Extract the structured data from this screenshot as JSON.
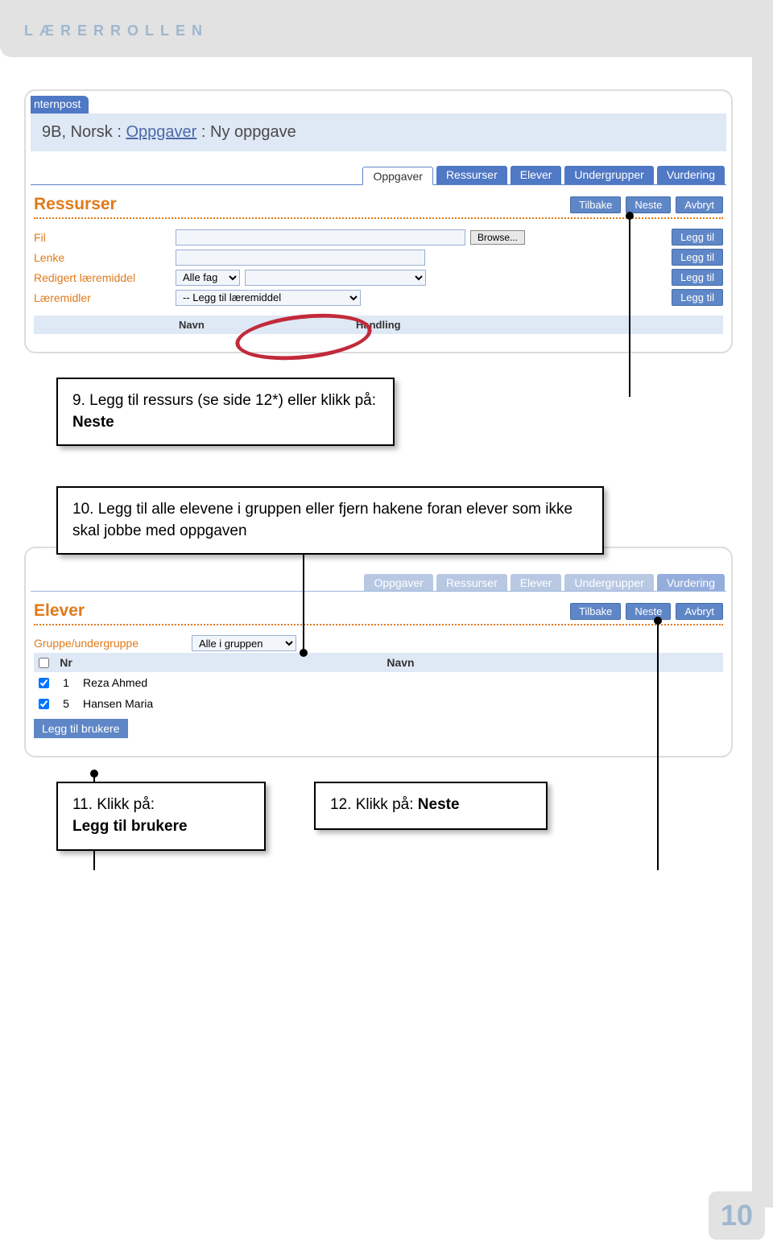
{
  "header": {
    "title": "LÆRERROLLEN"
  },
  "page_number": "10",
  "shot1": {
    "corner_tab": "nternpost",
    "breadcrumb": {
      "prefix": "9B, Norsk : ",
      "link": "Oppgaver",
      "suffix": " : Ny oppgave"
    },
    "tabs": [
      "Oppgaver",
      "Ressurser",
      "Elever",
      "Undergrupper",
      "Vurdering"
    ],
    "section_title": "Ressurser",
    "action_buttons": [
      "Tilbake",
      "Neste",
      "Avbryt"
    ],
    "rows": {
      "fil": {
        "label": "Fil",
        "browse": "Browse...",
        "add": "Legg til"
      },
      "lenke": {
        "label": "Lenke",
        "add": "Legg til"
      },
      "redigert": {
        "label": "Redigert læremiddel",
        "select": "Alle fag",
        "add": "Legg til"
      },
      "laeremidler": {
        "label": "Læremidler",
        "select": "-- Legg til læremiddel",
        "add": "Legg til"
      }
    },
    "table_headers": {
      "navn": "Navn",
      "handling": "Handling"
    }
  },
  "callout9": "9. Legg til ressurs (se side 12*) eller klikk på: ",
  "callout9_bold": "Neste",
  "callout10": "10. Legg til alle elevene i gruppen eller fjern hakene foran elever som ikke skal jobbe med oppgaven",
  "shot2": {
    "tabs": [
      "Oppgaver",
      "Ressurser",
      "Elever",
      "Undergrupper",
      "Vurdering"
    ],
    "section_title": "Elever",
    "action_buttons": [
      "Tilbake",
      "Neste",
      "Avbryt"
    ],
    "group_label": "Gruppe/undergruppe",
    "group_select": "Alle i gruppen",
    "cols": {
      "nr": "Nr",
      "navn": "Navn"
    },
    "students": [
      {
        "nr": "1",
        "name": "Reza Ahmed"
      },
      {
        "nr": "5",
        "name": "Hansen Maria"
      }
    ],
    "add_users": "Legg til brukere"
  },
  "callout11_prefix": "11. Klikk på:",
  "callout11_bold": "Legg til brukere",
  "callout12_prefix": "12. Klikk på: ",
  "callout12_bold": "Neste"
}
